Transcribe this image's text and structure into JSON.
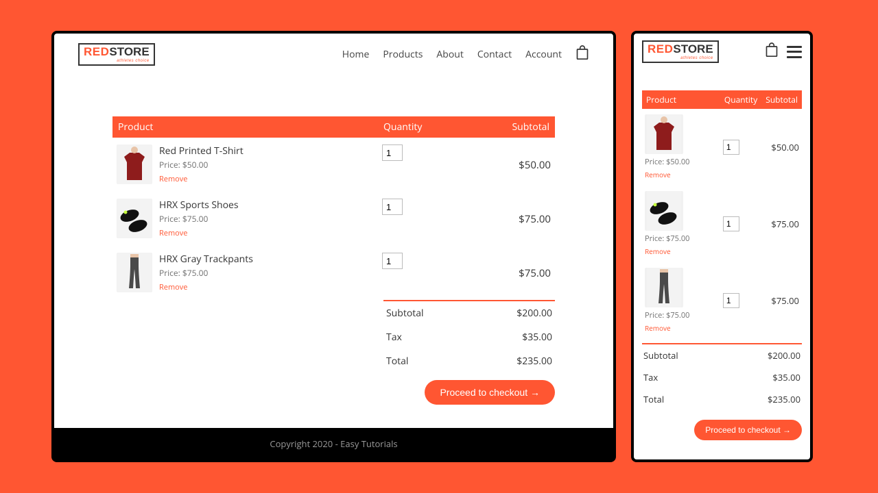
{
  "brand": {
    "red": "RED",
    "store": "STORE",
    "tagline": "athletes choice"
  },
  "nav": {
    "items": [
      "Home",
      "Products",
      "About",
      "Contact",
      "Account"
    ]
  },
  "headers": {
    "product": "Product",
    "quantity": "Quantity",
    "subtotal": "Subtotal"
  },
  "items": [
    {
      "name": "Red Printed T-Shirt",
      "price_label": "Price: $50.00",
      "remove": "Remove",
      "qty": "1",
      "subtotal": "$50.00"
    },
    {
      "name": "HRX Sports Shoes",
      "price_label": "Price: $75.00",
      "remove": "Remove",
      "qty": "1",
      "subtotal": "$75.00"
    },
    {
      "name": "HRX Gray Trackpants",
      "price_label": "Price: $75.00",
      "remove": "Remove",
      "qty": "1",
      "subtotal": "$75.00"
    }
  ],
  "totals": {
    "subtotal_label": "Subtotal",
    "subtotal": "$200.00",
    "tax_label": "Tax",
    "tax": "$35.00",
    "total_label": "Total",
    "total": "$235.00"
  },
  "checkout_label": "Proceed to checkout →",
  "footer": "Copyright 2020 - Easy Tutorials"
}
